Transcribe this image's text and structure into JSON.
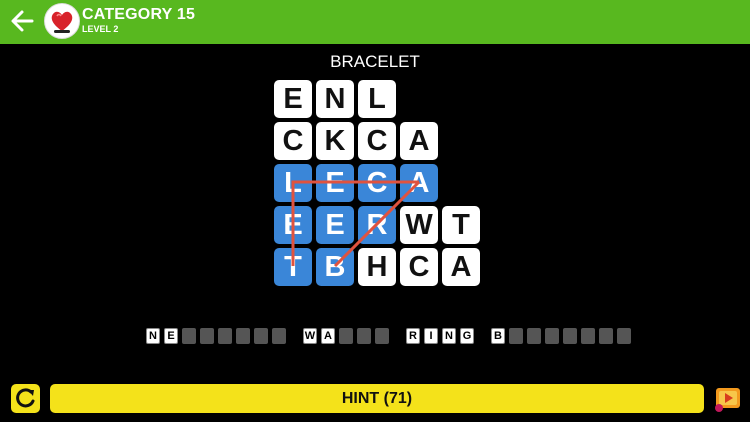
{
  "header": {
    "title": "CATEGORY 15",
    "level": "LEVEL 2"
  },
  "puzzle": {
    "word": "BRACELET",
    "rows": [
      [
        "E",
        "N",
        "L"
      ],
      [
        "C",
        "K",
        "C",
        "A"
      ],
      [
        "L",
        "E",
        "C",
        "A"
      ],
      [
        "E",
        "E",
        "R",
        "W",
        "T"
      ],
      [
        "T",
        "B",
        "H",
        "C",
        "A"
      ]
    ],
    "selected_cells": [
      [
        2,
        0
      ],
      [
        2,
        1
      ],
      [
        2,
        2
      ],
      [
        2,
        3
      ],
      [
        3,
        0
      ],
      [
        3,
        1
      ],
      [
        3,
        2
      ],
      [
        4,
        0
      ],
      [
        4,
        1
      ]
    ]
  },
  "answers": [
    {
      "letters": [
        "N",
        "E",
        "",
        "",
        "",
        "",
        "",
        ""
      ]
    },
    {
      "letters": [
        "W",
        "A",
        "",
        "",
        ""
      ]
    },
    {
      "letters": [
        "R",
        "I",
        "N",
        "G"
      ]
    },
    {
      "letters": [
        "B",
        "",
        "",
        "",
        "",
        "",
        "",
        ""
      ]
    }
  ],
  "footer": {
    "hint_label": "HINT (71)"
  },
  "colors": {
    "header": "#58b81f",
    "selected_tile": "#3a86d8",
    "button": "#f4e21a",
    "path": "#e0533f"
  }
}
